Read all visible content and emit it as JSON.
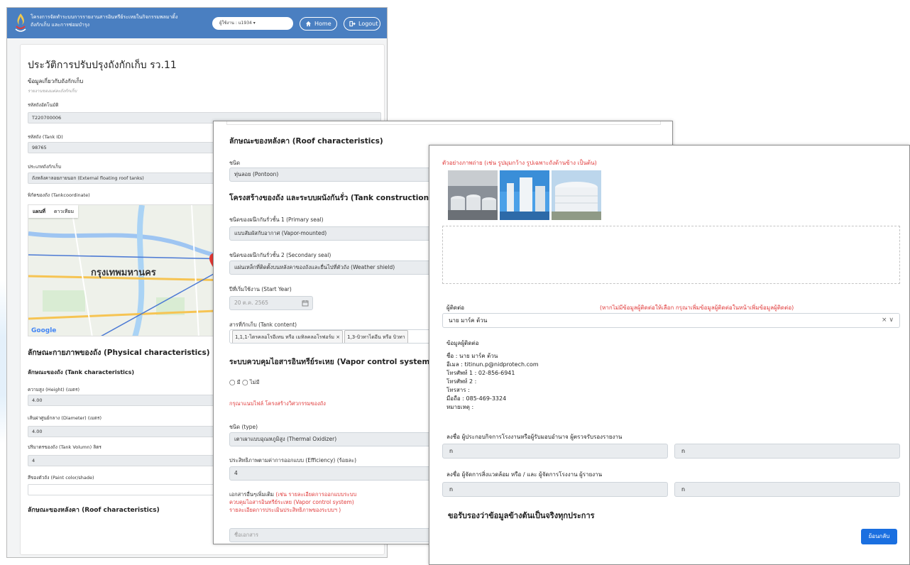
{
  "header": {
    "system_title_line1": "โครงการจัดทำระบบการรายงานสารอินทรีย์ระเหยในกิจกรรมพลมาดิ้ง",
    "system_title_line2": "ถังกักเก็บ และการซ่อมบำรุง",
    "user_label": "ผู้ใช้งาน : u1934 ▾",
    "home_label": "Home",
    "logout_label": "Logout"
  },
  "panel1": {
    "page_title": "ประวัติการปรับปรุงถังกักเก็บ รว.11",
    "info_heading": "ข้อมูลเกี่ยวกับถังกักเก็บ",
    "info_note": "รายงานของแต่ละถังกักเก็บ",
    "fields": [
      {
        "label": "รหัสถังอัตโนมัติ",
        "value": "T220700006"
      },
      {
        "label": "รหัสถัง (Tank ID)",
        "value": "98765"
      },
      {
        "label": "ประเภทถังกักเก็บ",
        "value": "ถังหลังคาลอยภายนอก (External floating roof tanks)"
      }
    ],
    "coord_label": "พิกัดของถัง (Tankcoordinate)",
    "map": {
      "tabs": [
        "แผนที่",
        "ดาวเทียม"
      ],
      "city_label": "กรุงเทพมหานคร",
      "attribution": "Google"
    },
    "physical_heading": "ลักษณะกายภาพของถัง (Physical characteristics)",
    "tank_char_heading": "ลักษณะของถัง (Tank characteristics)",
    "measures": [
      {
        "label": "ความสูง (Height) (เมตร)",
        "value": "4.00"
      },
      {
        "label": "เส้นผ่าศูนย์กลาง (Diameter) (เมตร)",
        "value": "4.00"
      },
      {
        "label": "ปริมาตรของถัง (Tank Volumn) ลิตร",
        "value": "4"
      },
      {
        "label": "สีของตัวถัง (Paint color/shade)",
        "value": ""
      }
    ],
    "roof_heading": "ลักษณะของหลังคา (Roof characteristics)"
  },
  "panel2": {
    "roof_heading": "ลักษณะของหลังคา (Roof characteristics)",
    "type_label": "ชนิด",
    "type_value": "ทุ่นลอย (Pontoon)",
    "construction_heading": "โครงสร้างของถัง และระบบผนังกันรั่ว (Tank construction",
    "primary_seal_label": "ชนิดของผนึกกันรั่วชั้น 1 (Primary seal)",
    "primary_seal_value": "แบบสัมผัสกับอากาศ (Vapor-mounted)",
    "secondary_seal_label": "ชนิดของผนึกกันรั่วชั้น 2 (Secondary seal)",
    "secondary_seal_value": "แผ่นเหล็กที่ติดตั้งบนหลังคาของถังและยื่นไปที่ตัวถัง (Weather shield)",
    "start_year_label": "ปีที่เริ่มใช้งาน (Start Year)",
    "start_year_value": "20 ต.ค. 2565",
    "content_label": "สารที่กักเก็บ (Tank content)",
    "content_chips": [
      "1,1,1-ไตรคลอโรอีเทน หรือ เมทิลคลอโรฟอร์ม ×",
      "1,3-บิวทาไดอีน หรือ บิวทา"
    ],
    "vapor_heading": "ระบบควบคุมไอสารอินทรีย์ระเหย (Vapor control system)",
    "radio_text": "◯ มี ◯ ไม่มี",
    "attach_note": "กรุณาแนบไฟล์ โครงสร้างวิศวกรรมของถัง",
    "vtype_label": "ชนิด (type)",
    "vtype_value": "เตาเผาแบบอุณหภูมิสูง (Thermal Oxidizer)",
    "efficiency_label": "ประสิทธิภาพตามค่าการออกแบบ (Efficiency) (ร้อยละ)",
    "efficiency_value": "4",
    "docs_label": "เอกสารอื่นๆเพิ่มเติม",
    "docs_note_line1": "(เช่น รายละเอียดการออกแบบระบบ",
    "docs_note_line2": "ควบคุมไอสารอินทรีย์ระเหย (Vapor control system)",
    "docs_note_line3": "รายละเอียดการประเมินประสิทธิภาพของระบบฯ )",
    "doc_name_placeholder": "ชื่อเอกสาร"
  },
  "panel3": {
    "photo_note": "ตัวอย่างภาพถ่าย (เช่น รูปมุมกว้าง รูปเฉพาะถังด้านข้าง เป็นต้น)",
    "contact_label": "ผู้ติดต่อ",
    "contact_hint": "(หากไม่มีข้อมูลผู้ติดต่อให้เลือก กรุณาเพิ่มข้อมูลผู้ติดต่อในหน้าเพิ่มข้อมูลผู้ติดต่อ)",
    "contact_selected": "นาย มาร์ค ต้วน",
    "contact_info_heading": "ข้อมูลผู้ติดต่อ",
    "contact_lines": [
      "ชื่อ : นาย มาร์ค ต้วน",
      "อีเมล : titinun.p@nidprotech.com",
      "โทรศัพท์ 1 : 02-856-6941",
      "โทรศัพท์ 2 :",
      "โทรสาร :",
      "มือถือ : 085-469-3324",
      "หมายเหตุ :"
    ],
    "sign1_label": "ลงชื่อ ผู้ประกอบกิจการโรงงานหรือผู้รับมอบอำนาจ ผู้ตรวจรับรองรายงาน",
    "sign1_values": [
      "n",
      "n"
    ],
    "sign2_label": "ลงชื่อ ผู้จัดการสิ่งแวดล้อม หรือ / และ ผู้จัดการโรงงาน ผู้รายงาน",
    "sign2_values": [
      "n",
      "n"
    ],
    "certify_text": "ขอรับรองว่าข้อมูลข้างต้นเป็นจริงทุกประการ",
    "back_label": "ย้อนกลับ"
  },
  "colors": {
    "header_blue": "#4a7fc1",
    "accent_red": "#e03a3a",
    "primary_button": "#1a6fe0"
  }
}
